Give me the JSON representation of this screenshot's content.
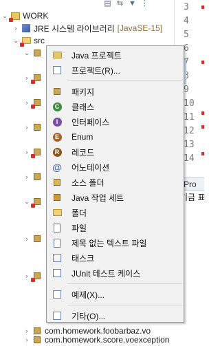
{
  "explorer": {
    "project_name": "WORK",
    "jre_label": "JRE 시스템 라이브러리",
    "jre_decoration": "[JavaSE-15]",
    "src_label": "src",
    "packages": [
      "com.homework.foobarbaz.vo",
      "com.homework.score.voexception"
    ]
  },
  "editor": {
    "line_numbers": [
      "3",
      "4",
      "5",
      "6",
      "7",
      "8",
      "9",
      "10",
      "11",
      "12",
      "13",
      "14"
    ],
    "error_lines": [
      "7",
      "11",
      "12",
      "14"
    ],
    "bottom_tab_label": "Pro",
    "bottom_sub_label": "기금 표"
  },
  "menu": {
    "items": [
      {
        "label": "Java 프로젝트",
        "icon": "java-project-icon"
      },
      {
        "label": "프로젝트(R)...",
        "icon": "project-icon"
      },
      {
        "label": "패키지",
        "icon": "package-icon"
      },
      {
        "label": "클래스",
        "icon": "class-icon"
      },
      {
        "label": "인터페이스",
        "icon": "interface-icon"
      },
      {
        "label": "Enum",
        "icon": "enum-icon"
      },
      {
        "label": "레코드",
        "icon": "record-icon"
      },
      {
        "label": "어노테이션",
        "icon": "annotation-icon"
      },
      {
        "label": "소스 폴더",
        "icon": "source-folder-icon"
      },
      {
        "label": "Java 작업 세트",
        "icon": "working-set-icon"
      },
      {
        "label": "폴더",
        "icon": "folder-icon"
      },
      {
        "label": "파일",
        "icon": "file-icon"
      },
      {
        "label": "제목 없는 텍스트 파일",
        "icon": "untitled-text-file-icon"
      },
      {
        "label": "태스크",
        "icon": "task-icon"
      },
      {
        "label": "JUnit 테스트 케이스",
        "icon": "junit-test-icon"
      },
      {
        "label": "예제(X)...",
        "icon": "example-icon"
      },
      {
        "label": "기타(O)...",
        "icon": "other-icon"
      }
    ]
  },
  "colors": {
    "error": "#d32f2f",
    "class_green": "#3c8d3c",
    "interface_purple": "#7a4ea3",
    "enum_brown": "#a0662a",
    "record_brown": "#8a5a1e"
  }
}
